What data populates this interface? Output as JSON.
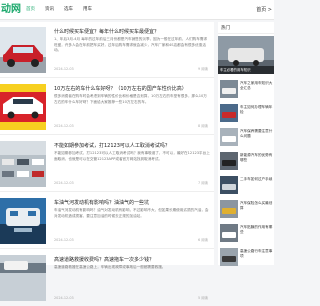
{
  "site": {
    "logo": "动网"
  },
  "nav": {
    "items": [
      "首页",
      "资讯",
      "选车",
      "用车"
    ],
    "active_index": 0,
    "right_label": "首页 >"
  },
  "articles": [
    {
      "title": "什么时候买车便宜？每年什么时候买车最便宜？",
      "summary": "1、年后3月-4月 每年的过年前后三月份都是汽车销售的淡季，因为一般在过年前，人们购车需求旺盛，许多人会在年前把车买好，过年后购车需求就会减少，汽车厂家和4S店都会有很多优惠活动。",
      "date": "2024-12-03",
      "count": "9 阅读"
    },
    {
      "title": "10万左右的车什么车好呀？（10万左右的国产车性价比高）",
      "summary": "很多消费者在购车时会考虑到车辆的性价比和价格是否划算，10万左右的车型有很多，那么10万左右的车什么车好呀？下面给大家推荐一些10万左右的车。",
      "date": "2024-12-03",
      "count": "8 阅读"
    },
    {
      "title": "不能如期参加考试，打12123可以人工取消考试吗？",
      "summary": "不能如期参加考试，打12123可以人工取消考试吗？我有事耽误了，不可以，最好在12123平台上面取消，也就是可以在交管12123APP或者官方网站找到取消考试。",
      "date": "2024-12-03",
      "count": "7 阅读"
    },
    {
      "title": "车油气河发动机有影响吗？油油气的一些坑",
      "summary": "车油气河发动机有影响吗？油气对发动机有影响，不过影响不大，但如果长期使用劣质的汽油，会对发动机造成损害，要注意加油的时候去正规的加油站。",
      "date": "2024-12-03",
      "count": "6 阅读"
    },
    {
      "title": "高速道路救援收费吗？高速拖车一次多少钱？",
      "summary": "高速道路救援在高速公路上，车辆出现故障或事故后一般都需要救援。",
      "date": "2024-12-03",
      "count": "5 阅读"
    }
  ],
  "sidebar": {
    "heading": "热门",
    "feature_caption": "车主必看的用车知识",
    "items": [
      {
        "title": "汽车之家用车知识大全汇总"
      },
      {
        "title": "车主如何办理车辆年检"
      },
      {
        "title": "汽车保养需要注意什么问题"
      },
      {
        "title": "新能源汽车的优势有哪些"
      },
      {
        "title": "二手车如何过户手续"
      },
      {
        "title": "汽车保险怎么买最划算"
      },
      {
        "title": "汽车贴膜的作用有哪些"
      },
      {
        "title": "高速公路行车注意事项"
      }
    ]
  },
  "colors": {
    "accent": "#1aa86b",
    "banner_red": "#d8232a",
    "banner_yellow": "#f7d020"
  }
}
